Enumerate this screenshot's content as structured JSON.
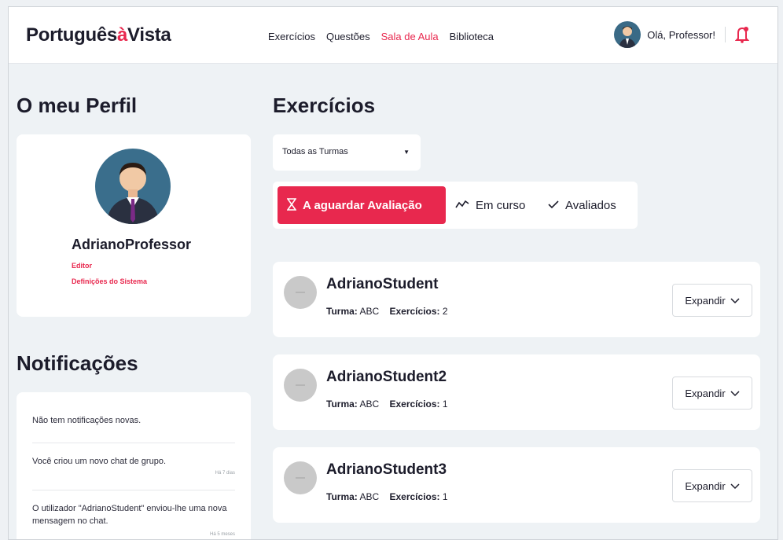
{
  "header": {
    "logo_main": "Português",
    "logo_accent": "à",
    "logo_end": "Vista",
    "nav": [
      "Exercícios",
      "Questões",
      "Sala de Aula",
      "Biblioteca"
    ],
    "active_nav": "Sala de Aula",
    "greeting": "Olá, Professor!"
  },
  "profile": {
    "title": "O meu Perfil",
    "name": "AdrianoProfessor",
    "role": "Editor",
    "settings_link": "Definições do Sistema"
  },
  "notifications": {
    "title": "Notificações",
    "items": [
      {
        "text": "Não tem notificações novas.",
        "time": ""
      },
      {
        "text": "Você criou um novo chat de grupo.",
        "time": "Há 7 dias"
      },
      {
        "text": "O utilizador \"AdrianoStudent\" enviou-lhe uma nova mensagem no chat.",
        "time": "Há 5 meses"
      }
    ]
  },
  "exercises": {
    "title": "Exercícios",
    "filter_value": "Todas as Turmas",
    "tabs": [
      {
        "label": "A aguardar Avaliação",
        "active": true
      },
      {
        "label": "Em curso",
        "active": false
      },
      {
        "label": "Avaliados",
        "active": false
      }
    ],
    "turma_label": "Turma:",
    "exercicios_label": "Exercícios:",
    "expand_label": "Expandir",
    "students": [
      {
        "name": "AdrianoStudent",
        "turma": "ABC",
        "exercicios": "2"
      },
      {
        "name": "AdrianoStudent2",
        "turma": "ABC",
        "exercicios": "1"
      },
      {
        "name": "AdrianoStudent3",
        "turma": "ABC",
        "exercicios": "1"
      }
    ]
  },
  "colors": {
    "accent": "#e8284e",
    "background": "#eef2f5"
  }
}
